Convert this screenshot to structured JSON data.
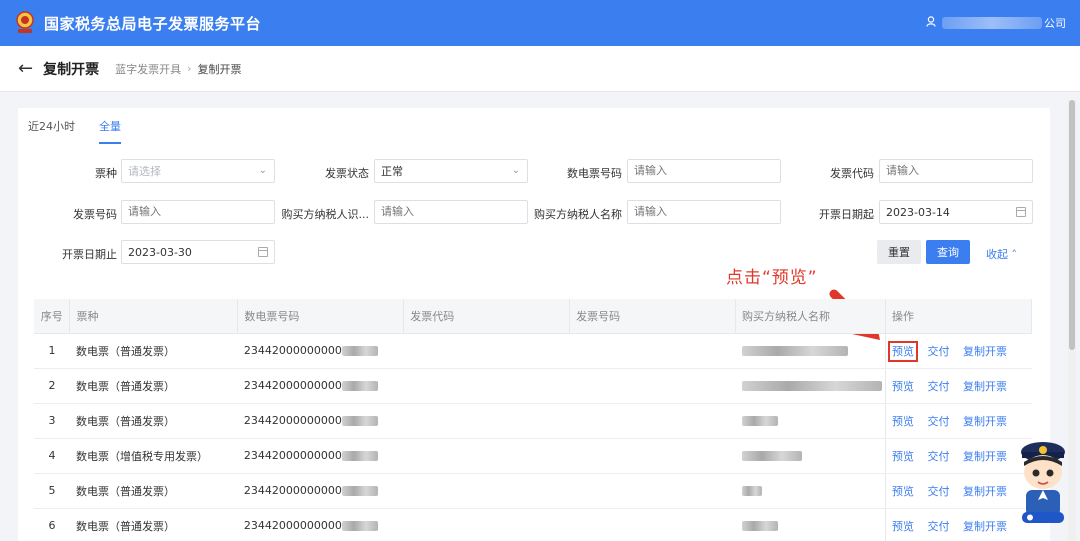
{
  "header": {
    "app_title": "国家税务总局电子发票服务平台",
    "user_suffix": "公司",
    "brand_color": "#3b7ef0"
  },
  "subheader": {
    "page_title": "复制开票",
    "breadcrumb": [
      "蓝字发票开具",
      "复制开票"
    ]
  },
  "tabs": [
    {
      "label": "近24小时",
      "active": false
    },
    {
      "label": "全量",
      "active": true
    }
  ],
  "filters": {
    "invoice_type": {
      "label": "票种",
      "placeholder": "请选择"
    },
    "invoice_status": {
      "label": "发票状态",
      "value": "正常"
    },
    "e_invoice_no": {
      "label": "数电票号码",
      "placeholder": "请输入"
    },
    "invoice_code": {
      "label": "发票代码",
      "placeholder": "请输入"
    },
    "invoice_no": {
      "label": "发票号码",
      "placeholder": "请输入"
    },
    "buyer_tax_id": {
      "label": "购买方纳税人识...",
      "placeholder": "请输入"
    },
    "buyer_name": {
      "label": "购买方纳税人名称",
      "placeholder": "请输入"
    },
    "date_start": {
      "label": "开票日期起",
      "value": "2023-03-14"
    },
    "date_end": {
      "label": "开票日期止",
      "value": "2023-03-30"
    }
  },
  "actions": {
    "reset": "重置",
    "query": "查询",
    "collapse": "收起"
  },
  "annotation": "点击“预览”",
  "table": {
    "headers": [
      "序号",
      "票种",
      "数电票号码",
      "发票代码",
      "发票号码",
      "购买方纳税人名称",
      "操作"
    ],
    "operations": [
      "预览",
      "交付",
      "复制开票"
    ],
    "rows": [
      {
        "no": "1",
        "type": "数电票（普通发票）",
        "e_no": "23442000000000"
      },
      {
        "no": "2",
        "type": "数电票（普通发票）",
        "e_no": "23442000000000"
      },
      {
        "no": "3",
        "type": "数电票（普通发票）",
        "e_no": "23442000000000"
      },
      {
        "no": "4",
        "type": "数电票（增值税专用发票）",
        "e_no": "23442000000000"
      },
      {
        "no": "5",
        "type": "数电票（普通发票）",
        "e_no": "23442000000000"
      },
      {
        "no": "6",
        "type": "数电票（普通发票）",
        "e_no": "23442000000000"
      }
    ]
  },
  "annotation_color": "#e0372a"
}
